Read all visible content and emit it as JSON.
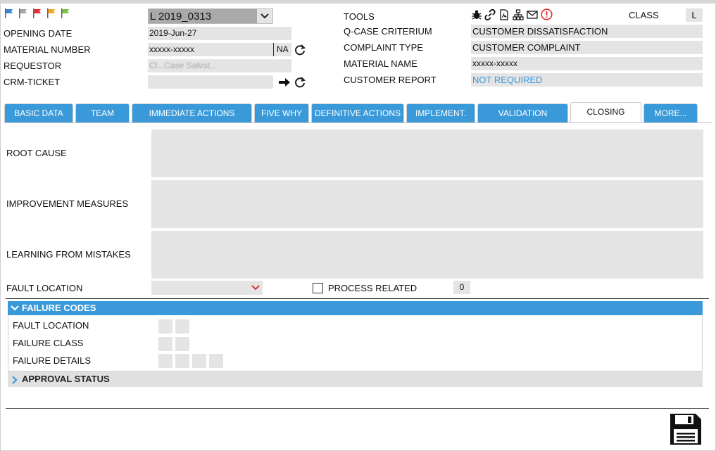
{
  "header": {
    "flags": [
      {
        "name": "blue-flag-icon",
        "color": "#3a86d1"
      },
      {
        "name": "gray-flag-icon",
        "color": "#a6a6a6"
      },
      {
        "name": "red-flag-icon",
        "color": "#e03030"
      },
      {
        "name": "orange-flag-icon",
        "color": "#f2a81e"
      },
      {
        "name": "green-flag-icon",
        "color": "#7cc242"
      }
    ],
    "case_select_value": "L 2019_0313",
    "opening_date_label": "OPENING DATE",
    "opening_date_value": "2019-Jun-27",
    "material_number_label": "MATERIAL NUMBER",
    "material_number_value": "xxxxx-xxxxx",
    "material_number_suffix": "NA",
    "requestor_label": "REQUESTOR",
    "requestor_value": "Cl...Case Salvat...",
    "crm_ticket_label": "CRM-TICKET",
    "crm_ticket_value": "",
    "tools_label": "TOOLS",
    "tool_icons": [
      "bug-icon",
      "link-icon",
      "pdf-icon",
      "hierarchy-icon",
      "mail-icon",
      "alert-icon"
    ],
    "class_label": "CLASS",
    "class_value": "L",
    "qcase_label": "Q-CASE CRITERIUM",
    "qcase_value": "CUSTOMER DISSATISFACTION",
    "complaint_type_label": "COMPLAINT TYPE",
    "complaint_type_value": "CUSTOMER COMPLAINT",
    "material_name_label": "MATERIAL NAME",
    "material_name_value": "xxxxx-xxxxx",
    "customer_report_label": "CUSTOMER REPORT",
    "customer_report_value": "NOT REQUIRED"
  },
  "tabs": [
    {
      "label": "BASIC DATA",
      "active": false
    },
    {
      "label": "TEAM",
      "active": false
    },
    {
      "label": "IMMEDIATE ACTIONS",
      "active": false
    },
    {
      "label": "FIVE WHY",
      "active": false
    },
    {
      "label": "DEFINITIVE ACTIONS",
      "active": false
    },
    {
      "label": "IMPLEMENT.",
      "active": false
    },
    {
      "label": "VALIDATION",
      "active": false
    },
    {
      "label": "CLOSING",
      "active": true
    },
    {
      "label": "MORE...",
      "active": false
    }
  ],
  "closing": {
    "root_cause_label": "ROOT CAUSE",
    "root_cause_value": "",
    "improvement_label": "IMPROVEMENT MEASURES",
    "improvement_value": "",
    "learning_label": "LEARNING FROM MISTAKES",
    "learning_value": "",
    "fault_location_label": "FAULT LOCATION",
    "fault_location_value": "",
    "process_related_label": "PROCESS RELATED",
    "process_related_checked": false,
    "process_related_count": "0"
  },
  "failure_codes": {
    "title": "FAILURE CODES",
    "fault_location_label": "FAULT LOCATION",
    "failure_class_label": "FAILURE CLASS",
    "failure_details_label": "FAILURE DETAILS"
  },
  "approval_status": {
    "title": "APPROVAL STATUS"
  },
  "colors": {
    "accent": "#3a9ad9",
    "field_bg": "#e4e4e4",
    "alert": "#e03030"
  }
}
